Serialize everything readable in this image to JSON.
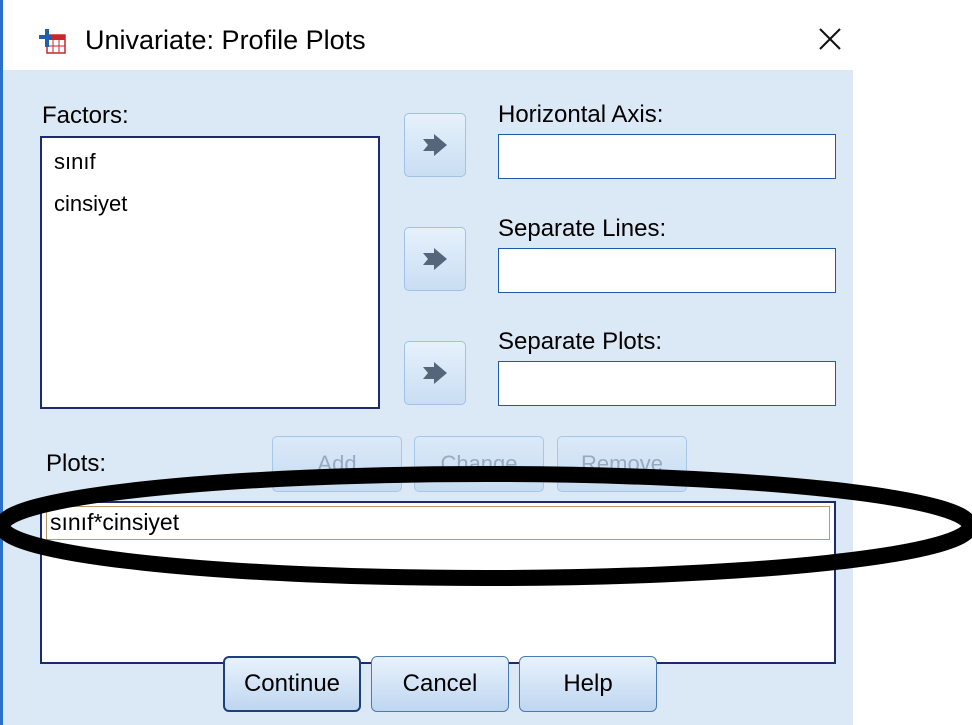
{
  "window": {
    "title": "Univariate: Profile Plots",
    "close_glyph": "✕"
  },
  "factors": {
    "label": "Factors:",
    "items": [
      "sınıf",
      "cinsiyet"
    ]
  },
  "horizontal_axis": {
    "label": "Horizontal Axis:",
    "value": ""
  },
  "separate_lines": {
    "label": "Separate Lines:",
    "value": ""
  },
  "separate_plots": {
    "label": "Separate Plots:",
    "value": ""
  },
  "plots": {
    "label": "Plots:",
    "add_label": "Add",
    "change_label": "Change",
    "remove_label": "Remove",
    "items": [
      "sınıf*cinsiyet"
    ]
  },
  "buttons": {
    "continue": "Continue",
    "cancel": "Cancel",
    "help": "Help"
  },
  "colors": {
    "dialog_bg": "#dbe8f5",
    "border_accent": "#2a72c9",
    "listbox_border": "#1d2a6e"
  }
}
